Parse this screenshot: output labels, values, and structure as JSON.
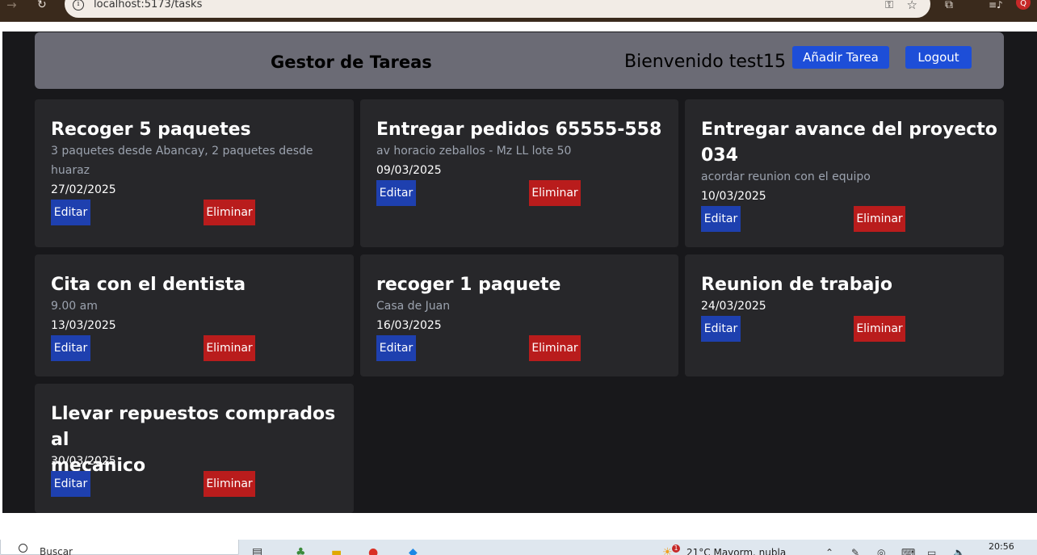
{
  "browser": {
    "url": "localhost:5173/tasks",
    "profile_initial": "Q"
  },
  "header": {
    "app_title": "Gestor de Tareas",
    "welcome": "Bienvenido test15",
    "add_task_label": "Añadir Tarea",
    "logout_label": "Logout"
  },
  "tasks": [
    {
      "title_lines": [
        "Recoger 5 paquetes"
      ],
      "description_lines": [
        "3 paquetes desde Abancay, 2 paquetes desde",
        "huaraz"
      ],
      "date": "27/02/2025",
      "edit_label": "Editar",
      "delete_label": "Eliminar"
    },
    {
      "title_lines": [
        "Entregar pedidos 65555-558"
      ],
      "description_lines": [
        "av horacio zeballos - Mz LL lote 50"
      ],
      "date": "09/03/2025",
      "edit_label": "Editar",
      "delete_label": "Eliminar"
    },
    {
      "title_lines": [
        "Entregar avance del proyecto",
        "034"
      ],
      "description_lines": [
        "acordar reunion con el equipo"
      ],
      "date": "10/03/2025",
      "edit_label": "Editar",
      "delete_label": "Eliminar"
    },
    {
      "title_lines": [
        "Cita con el dentista"
      ],
      "description_lines": [
        "9.00 am"
      ],
      "date": "13/03/2025",
      "edit_label": "Editar",
      "delete_label": "Eliminar"
    },
    {
      "title_lines": [
        "recoger 1 paquete"
      ],
      "description_lines": [
        "Casa de Juan"
      ],
      "date": "16/03/2025",
      "edit_label": "Editar",
      "delete_label": "Eliminar"
    },
    {
      "title_lines": [
        "Reunion de trabajo"
      ],
      "description_lines": [],
      "date": "24/03/2025",
      "edit_label": "Editar",
      "delete_label": "Eliminar"
    },
    {
      "title_lines": [
        "Llevar repuestos comprados al",
        "mecanico"
      ],
      "description_lines": [],
      "date": "30/03/2025",
      "edit_label": "Editar",
      "delete_label": "Eliminar"
    }
  ],
  "taskbar": {
    "search_placeholder": "Buscar",
    "weather": "21°C  Mayorm. nubla",
    "clock": "20:56",
    "notification_count": "1"
  },
  "colors": {
    "app_background": "#18181b",
    "header_background": "#6b6b75",
    "card_background": "#27272a",
    "primary_button": "#1d4ed8",
    "edit_button": "#1e40af",
    "delete_button": "#b91c1c"
  }
}
